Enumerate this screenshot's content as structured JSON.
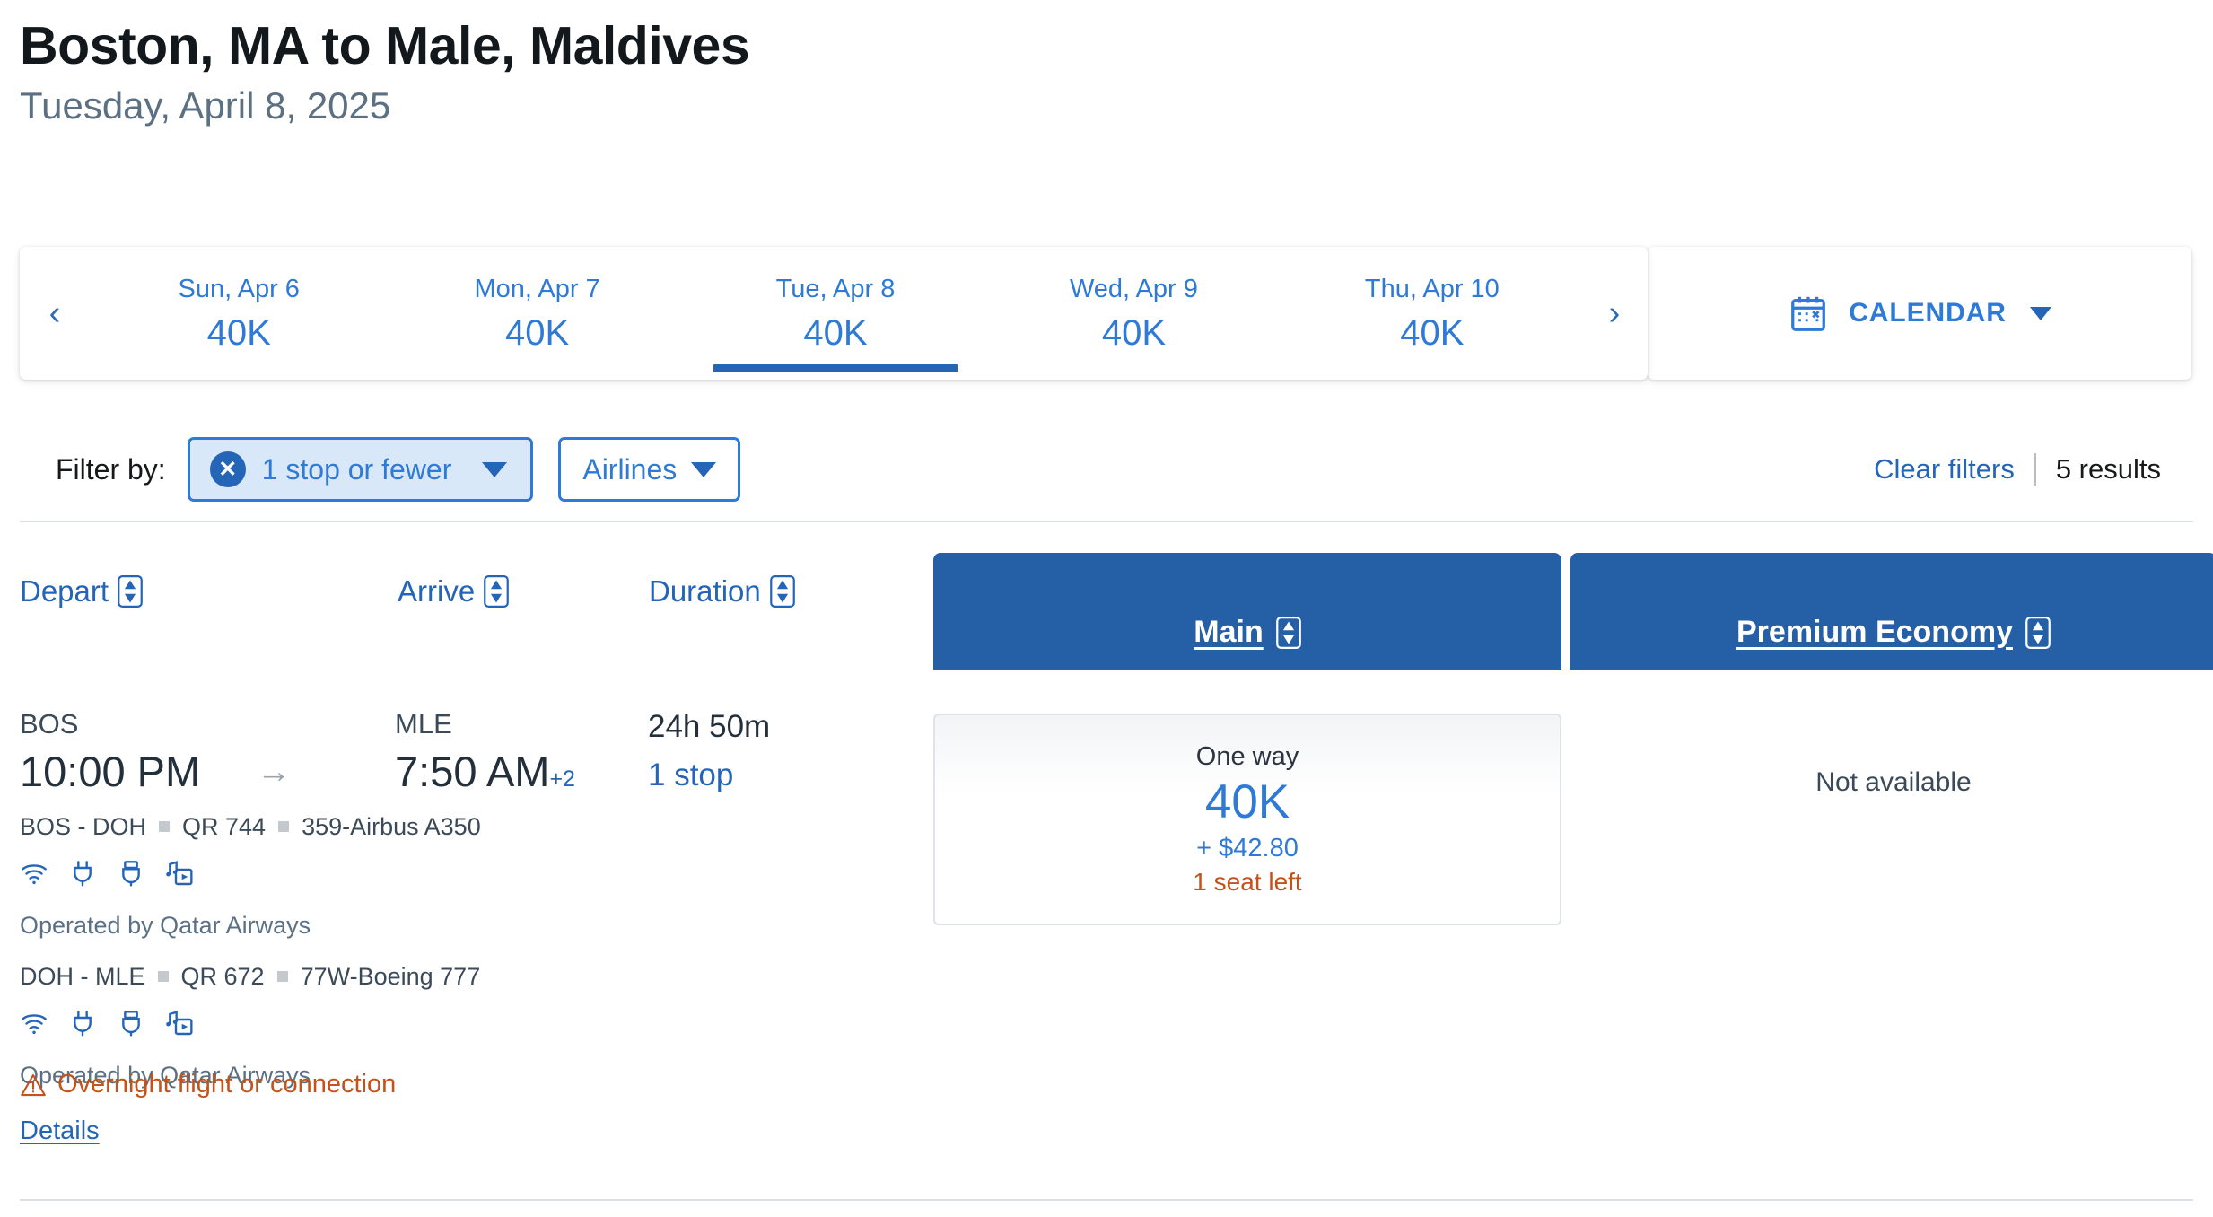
{
  "header": {
    "title": "Boston, MA to Male, Maldives",
    "subtitle": "Tuesday, April 8, 2025"
  },
  "date_strip": {
    "prev_arrow": "‹",
    "next_arrow": "›",
    "days": [
      {
        "label": "Sun, Apr 6",
        "price": "40K",
        "selected": false
      },
      {
        "label": "Mon, Apr 7",
        "price": "40K",
        "selected": false
      },
      {
        "label": "Tue, Apr 8",
        "price": "40K",
        "selected": true
      },
      {
        "label": "Wed, Apr 9",
        "price": "40K",
        "selected": false
      },
      {
        "label": "Thu, Apr 10",
        "price": "40K",
        "selected": false
      }
    ],
    "calendar_label": "CALENDAR",
    "calendar_icon": "calendar-icon"
  },
  "filters": {
    "label": "Filter by:",
    "active_chip": {
      "text": "1 stop or fewer",
      "remove_icon": "close-circle-icon",
      "glyph": "✕"
    },
    "airlines_button": "Airlines",
    "clear_filters": "Clear filters",
    "divider": "|",
    "results_count": "5 results"
  },
  "columns": {
    "depart": "Depart",
    "arrive": "Arrive",
    "duration": "Duration",
    "sort_icon": "sort-updown-icon"
  },
  "fare_classes": [
    {
      "name": "Main"
    },
    {
      "name": "Premium Economy"
    }
  ],
  "flight": {
    "depart_code": "BOS",
    "depart_time": "10:00 PM",
    "arrow": "→",
    "arrive_code": "MLE",
    "arrive_time": "7:50 AM",
    "arrive_day_offset": "+2",
    "duration": "24h 50m",
    "stops": "1 stop",
    "segments": [
      {
        "route": "BOS - DOH",
        "flight_number": "QR 744",
        "aircraft": "359-Airbus A350",
        "amenities": [
          "wifi-icon",
          "power-outlet-icon",
          "usb-port-icon",
          "entertainment-icon"
        ],
        "operated_by": "Operated by Qatar Airways"
      },
      {
        "route": "DOH - MLE",
        "flight_number": "QR 672",
        "aircraft": "77W-Boeing 777",
        "amenities": [
          "wifi-icon",
          "power-outlet-icon",
          "usb-port-icon",
          "entertainment-icon"
        ],
        "operated_by": "Operated by Qatar Airways"
      }
    ],
    "warning": {
      "icon": "warning-triangle-icon",
      "text": "Overnight flight or connection"
    },
    "details_link": "Details",
    "fares": {
      "main": {
        "trip_type": "One way",
        "miles": "40K",
        "taxes": "+ $42.80",
        "seats_left": "1 seat left"
      },
      "premium_economy": {
        "status": "Not available"
      }
    }
  },
  "colors": {
    "brand_blue": "#2565b8",
    "link_blue": "#2e7ad6",
    "header_panel": "#2560a6",
    "chip_bg": "#d8e8f8",
    "warning_orange": "#c4521a",
    "text_dark": "#23303c",
    "text_muted": "#5c7084"
  }
}
